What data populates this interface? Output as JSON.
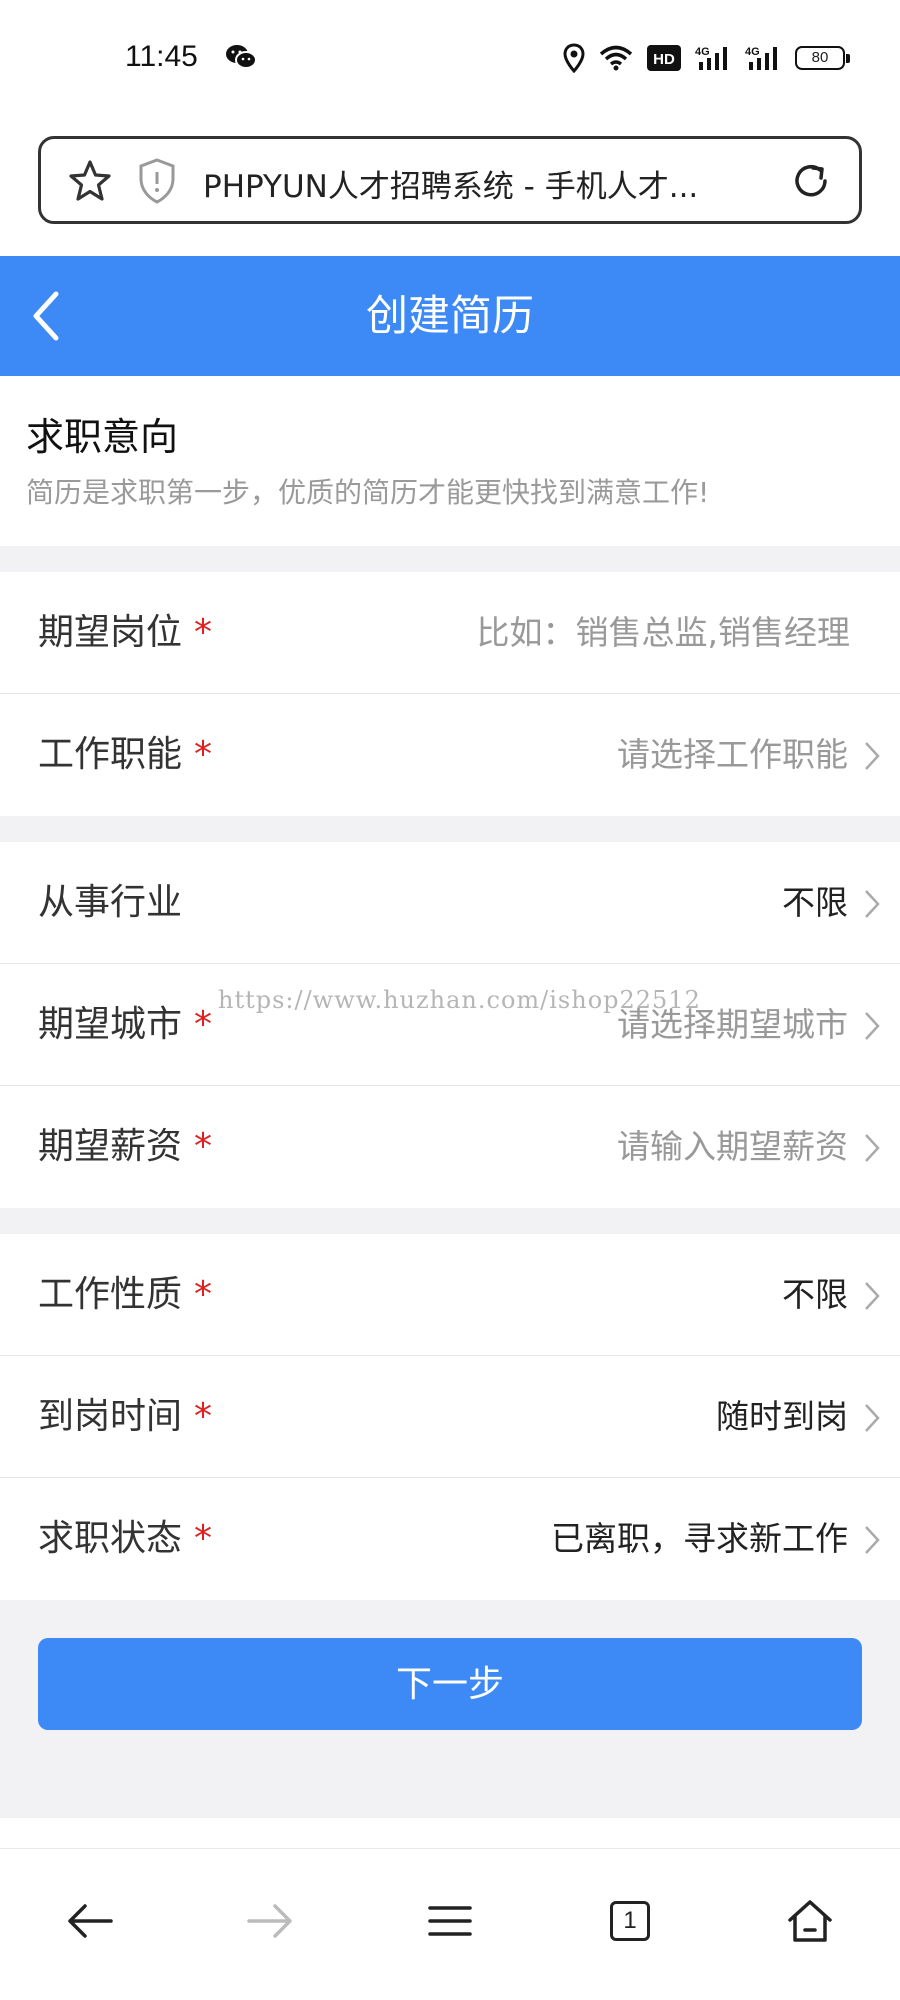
{
  "status_bar": {
    "time": "11:45",
    "icons": [
      "wechat-icon",
      "location-icon",
      "wifi-icon",
      "hd-icon",
      "signal-4g-icon",
      "signal-4g-icon"
    ],
    "hd_label": "HD",
    "network_label_1": "4G",
    "network_label_2": "4G",
    "battery": "80"
  },
  "browser": {
    "url_text": "PHPYUN人才招聘系统 - 手机人才...",
    "tab_count": "1"
  },
  "header": {
    "title": "创建简历",
    "color": "#3d8af7"
  },
  "intro": {
    "title": "求职意向",
    "description": "简历是求职第一步，优质的简历才能更快找到满意工作!"
  },
  "form": {
    "rows": [
      {
        "label": "期望岗位",
        "required": "*",
        "value": "比如：销售总监,销售经理",
        "placeholder": true
      },
      {
        "label": "工作职能",
        "required": "*",
        "value": "请选择工作职能",
        "placeholder": true
      },
      {
        "label": "从事行业",
        "required": "",
        "value": "不限",
        "placeholder": false
      },
      {
        "label": "期望城市",
        "required": "*",
        "value": "请选择期望城市",
        "placeholder": true
      },
      {
        "label": "期望薪资",
        "required": "*",
        "value": "请输入期望薪资",
        "placeholder": true
      },
      {
        "label": "工作性质",
        "required": "*",
        "value": "不限",
        "placeholder": false
      },
      {
        "label": "到岗时间",
        "required": "*",
        "value": "随时到岗",
        "placeholder": false
      },
      {
        "label": "求职状态",
        "required": "*",
        "value": "已离职，寻求新工作",
        "placeholder": false
      }
    ]
  },
  "watermark": "https://www.huzhan.com/ishop22512",
  "actions": {
    "next_label": "下一步"
  },
  "colors": {
    "accent": "#3d8af7",
    "required": "#e02020",
    "placeholder": "#999999",
    "section_gap": "#f2f2f4"
  }
}
